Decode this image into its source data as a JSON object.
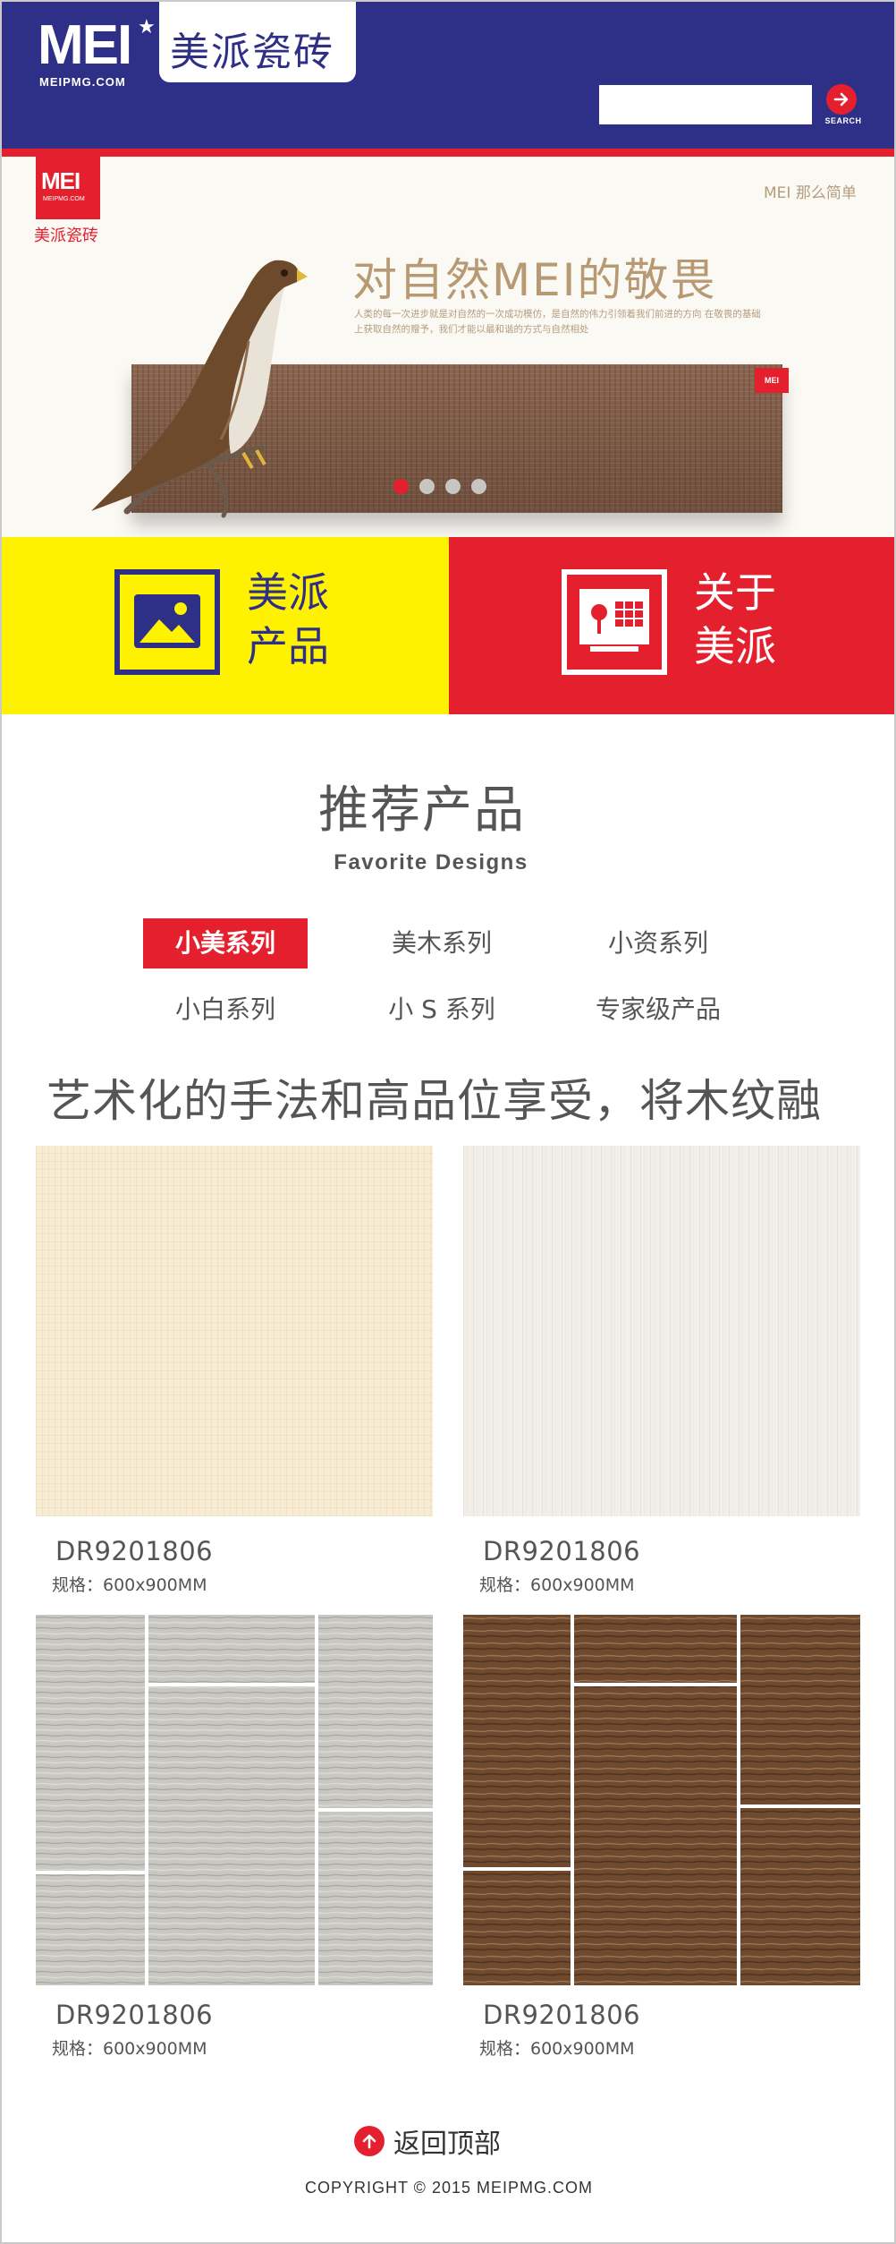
{
  "header": {
    "logo_text": "MEI",
    "logo_domain": "MEIPMG.COM",
    "logo_cn": "美派瓷砖",
    "search": {
      "placeholder": "",
      "value": "",
      "button_label": "SEARCH"
    },
    "brand_color": "#2e2f86",
    "accent_color": "#e4202f"
  },
  "banner": {
    "logo_text": "MEI",
    "logo_domain": "MEIPMG.COM",
    "logo_cn": "美派瓷砖",
    "slogan_mini": "MEI 那么简单",
    "headline": "对自然MEI的敬畏",
    "subtext": "人类的每一次进步就是对自然的一次成功模仿，是自然的伟力引领着我们前进的方向 在敬畏的基础上获取自然的赠予，我们才能以最和谐的方式与自然相处",
    "tag": "MEI",
    "slides": 4,
    "active_slide": 1
  },
  "tiles": [
    {
      "label_line1": "美派",
      "label_line2": "产品",
      "icon": "image-icon",
      "color": "#fff200"
    },
    {
      "label_line1": "关于",
      "label_line2": "美派",
      "icon": "building-icon",
      "color": "#e4202f"
    }
  ],
  "section": {
    "title": "推荐产品",
    "subtitle": "Favorite Designs"
  },
  "tabs": [
    {
      "label": "小美系列",
      "active": true
    },
    {
      "label": "美木系列",
      "active": false
    },
    {
      "label": "小资系列",
      "active": false
    },
    {
      "label": "小白系列",
      "active": false
    },
    {
      "label": "小 S 系列",
      "active": false
    },
    {
      "label": "专家级产品",
      "active": false
    }
  ],
  "marquee": "艺术化的手法和高品位享受，将木纹融",
  "products": [
    {
      "code": "DR9201806",
      "spec": "规格：600x900MM",
      "texture": "cream"
    },
    {
      "code": "DR9201806",
      "spec": "规格：600x900MM",
      "texture": "white-grain"
    },
    {
      "code": "DR9201806",
      "spec": "规格：600x900MM",
      "texture": "grey-wood-tiles"
    },
    {
      "code": "DR9201806",
      "spec": "规格：600x900MM",
      "texture": "brown-wood-tiles"
    }
  ],
  "footer": {
    "back_to_top": "返回顶部",
    "copyright": "COPYRIGHT  © 2015 MEIPMG.COM"
  }
}
